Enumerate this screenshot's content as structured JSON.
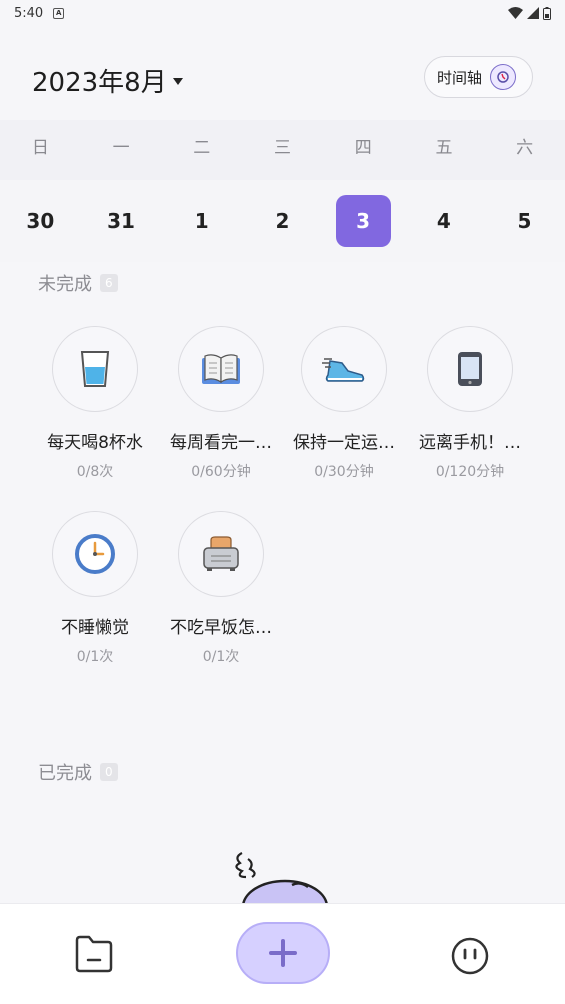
{
  "status_bar": {
    "time": "5:40",
    "notification_icon": "A"
  },
  "header": {
    "month_title": "2023年8月",
    "timeline_label": "时间轴"
  },
  "week": {
    "weekdays": [
      "日",
      "一",
      "二",
      "三",
      "四",
      "五",
      "六"
    ],
    "dates": [
      "30",
      "31",
      "1",
      "2",
      "3",
      "4",
      "5"
    ],
    "selected_date": "3",
    "accent_color": "#8168e0"
  },
  "incomplete": {
    "label": "未完成",
    "count": "6",
    "habits": [
      {
        "name": "每天喝8杯水",
        "progress": "0/8次",
        "icon": "water-glass-icon"
      },
      {
        "name": "每周看完一…",
        "progress": "0/60分钟",
        "icon": "book-icon"
      },
      {
        "name": "保持一定运…",
        "progress": "0/30分钟",
        "icon": "running-shoe-icon"
      },
      {
        "name": "远离手机！…",
        "progress": "0/120分钟",
        "icon": "phone-icon"
      },
      {
        "name": "不睡懒觉",
        "progress": "0/1次",
        "icon": "alarm-clock-icon"
      },
      {
        "name": "不吃早饭怎…",
        "progress": "0/1次",
        "icon": "toaster-icon"
      }
    ]
  },
  "completed": {
    "label": "已完成",
    "count": "0"
  },
  "bottom_nav": {
    "left_icon": "folder-icon",
    "center_icon": "plus-icon",
    "right_icon": "face-icon"
  }
}
